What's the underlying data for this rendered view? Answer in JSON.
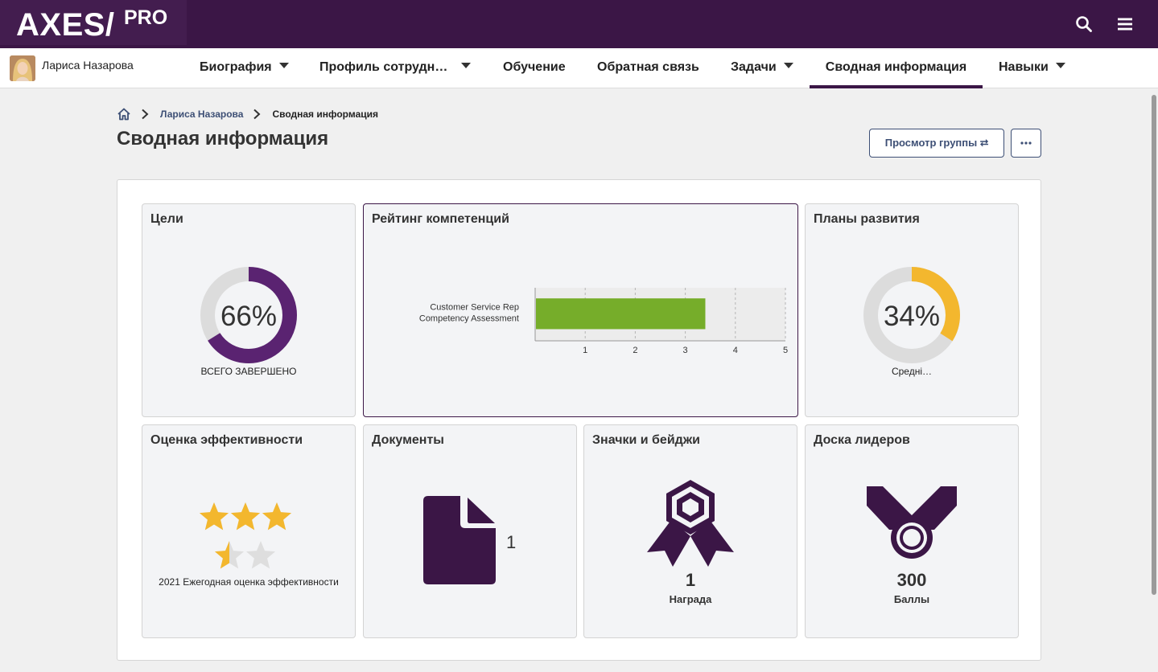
{
  "app": {
    "logo_main": "AXES/",
    "logo_sup": "PRO"
  },
  "user": {
    "name": "Лариса Назарова"
  },
  "nav": [
    {
      "label": "Биография",
      "dropdown": true
    },
    {
      "label": "Профиль сотрудн…",
      "dropdown": true
    },
    {
      "label": "Обучение",
      "dropdown": false
    },
    {
      "label": "Обратная связь",
      "dropdown": false
    },
    {
      "label": "Задачи",
      "dropdown": true
    },
    {
      "label": "Сводная информация",
      "dropdown": false,
      "active": true
    },
    {
      "label": "Навыки",
      "dropdown": true
    }
  ],
  "breadcrumb": {
    "link": "Лариса Назарова",
    "current": "Сводная информация"
  },
  "page": {
    "title": "Сводная информация",
    "group_view_label": "Просмотр группы ⮂",
    "more_label": "•••"
  },
  "tiles": {
    "goals": {
      "title": "Цели",
      "percent_label": "66%",
      "percent": 0.66,
      "caption": "ВСЕГО ЗАВЕРШЕНО",
      "color": "#5a2371"
    },
    "competency": {
      "title": "Рейтинг компетенций"
    },
    "development": {
      "title": "Планы развития",
      "percent_label": "34%",
      "percent": 0.34,
      "caption": "Средні…",
      "color": "#f3b72e"
    },
    "performance": {
      "title": "Оценка эффективности",
      "rating": 3.5,
      "max_rating": 5,
      "caption": "2021 Ежегодная оценка эффективности"
    },
    "documents": {
      "title": "Документы",
      "count": "1",
      "icon": "document-icon"
    },
    "badges": {
      "title": "Значки и бейджи",
      "count": "1",
      "caption": "Награда",
      "icon": "award-ribbon-icon"
    },
    "leaderboard": {
      "title": "Доска лидеров",
      "count": "300",
      "caption": "Баллы",
      "icon": "medal-icon"
    }
  },
  "chart_data": {
    "type": "bar",
    "orientation": "horizontal",
    "categories": [
      "Customer Service Rep Competency Assessment"
    ],
    "category_lines": [
      "Customer Service Rep",
      "Competency Assessment"
    ],
    "values": [
      3.4
    ],
    "x_ticks": [
      "1",
      "2",
      "3",
      "4",
      "5"
    ],
    "xlim": [
      0,
      5
    ],
    "grid": true,
    "bar_color": "#76ad2a"
  }
}
